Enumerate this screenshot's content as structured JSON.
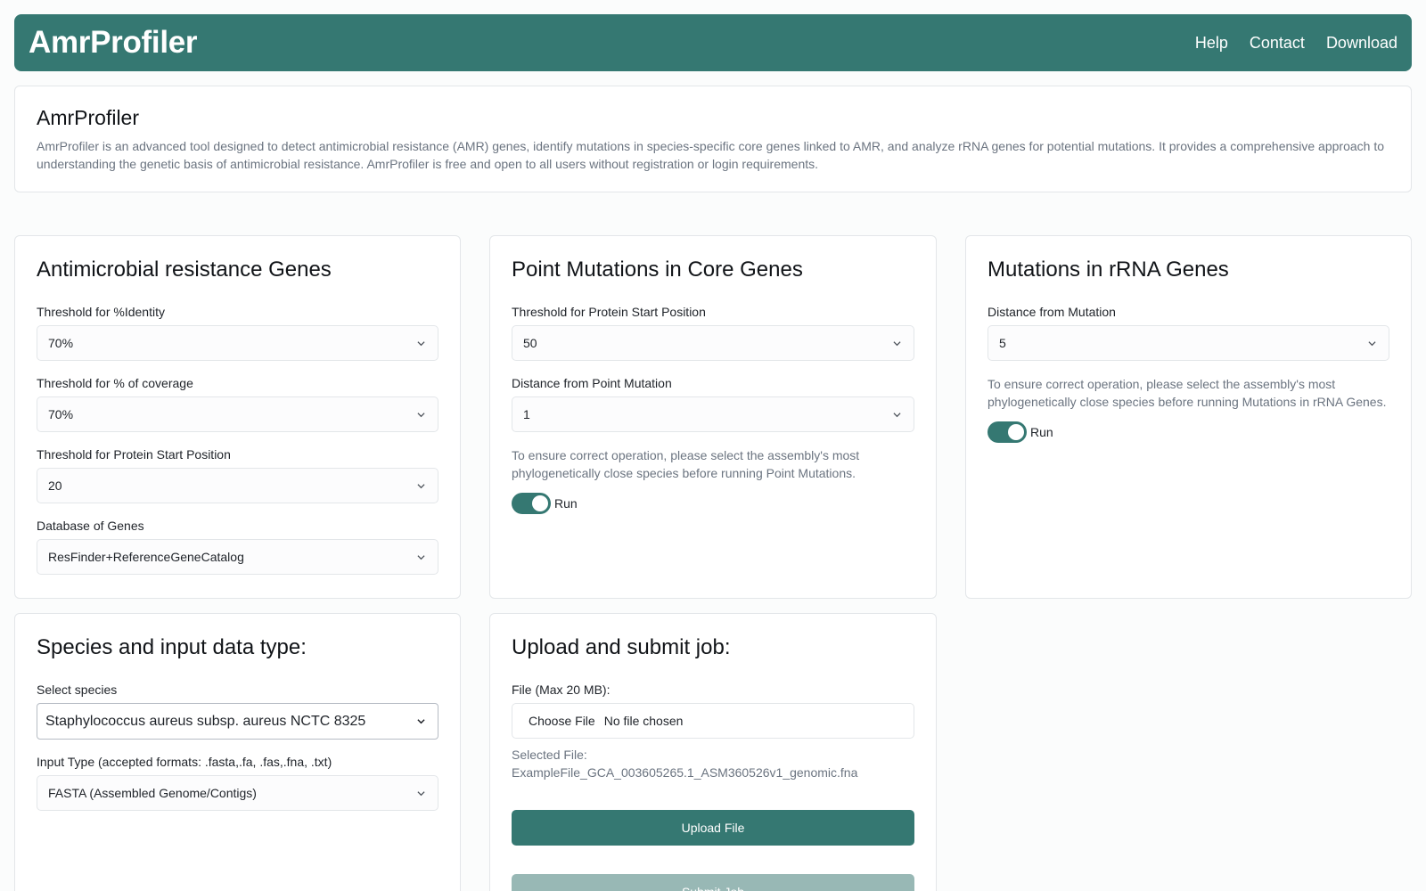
{
  "nav": {
    "brand": "AmrProfiler",
    "links": [
      "Help",
      "Contact",
      "Download"
    ]
  },
  "intro": {
    "title": "AmrProfiler",
    "description": "AmrProfiler is an advanced tool designed to detect antimicrobial resistance (AMR) genes, identify mutations in species-specific core genes linked to AMR, and analyze rRNA genes for potential mutations. It provides a comprehensive approach to understanding the genetic basis of antimicrobial resistance. AmrProfiler is free and open to all users without registration or login requirements."
  },
  "amr": {
    "title": "Antimicrobial resistance Genes",
    "identity_label": "Threshold for %Identity",
    "identity_value": "70%",
    "coverage_label": "Threshold for % of coverage",
    "coverage_value": "70%",
    "start_label": "Threshold for Protein Start Position",
    "start_value": "20",
    "db_label": "Database of Genes",
    "db_value": "ResFinder+ReferenceGeneCatalog"
  },
  "point": {
    "title": "Point Mutations in Core Genes",
    "start_label": "Threshold for Protein Start Position",
    "start_value": "50",
    "distance_label": "Distance from Point Mutation",
    "distance_value": "1",
    "note": "To ensure correct operation, please select the assembly's most phylogenetically close species before running Point Mutations.",
    "run_label": "Run"
  },
  "rrna": {
    "title": "Mutations in rRNA Genes",
    "distance_label": "Distance from Mutation",
    "distance_value": "5",
    "note": "To ensure correct operation, please select the assembly's most phylogenetically close species before running Mutations in rRNA Genes.",
    "run_label": "Run"
  },
  "species": {
    "title": "Species and input data type:",
    "species_label": "Select species",
    "species_value": "Staphylococcus aureus subsp. aureus NCTC 8325",
    "input_label": "Input Type (accepted formats: .fasta,.fa, .fas,.fna, .txt)",
    "input_value": "FASTA (Assembled Genome/Contigs)"
  },
  "upload": {
    "title": "Upload and submit job:",
    "file_label": "File (Max 20 MB):",
    "choose_label": "Choose File",
    "file_status": "No file chosen",
    "selected_label": "Selected File:",
    "selected_name": "ExampleFile_GCA_003605265.1_ASM360526v1_genomic.fna",
    "upload_label": "Upload File",
    "submit_label": "Submit Job"
  },
  "colors": {
    "accent": "#357872",
    "accent_disabled": "#98b8b5",
    "muted_text": "#6b7480"
  }
}
